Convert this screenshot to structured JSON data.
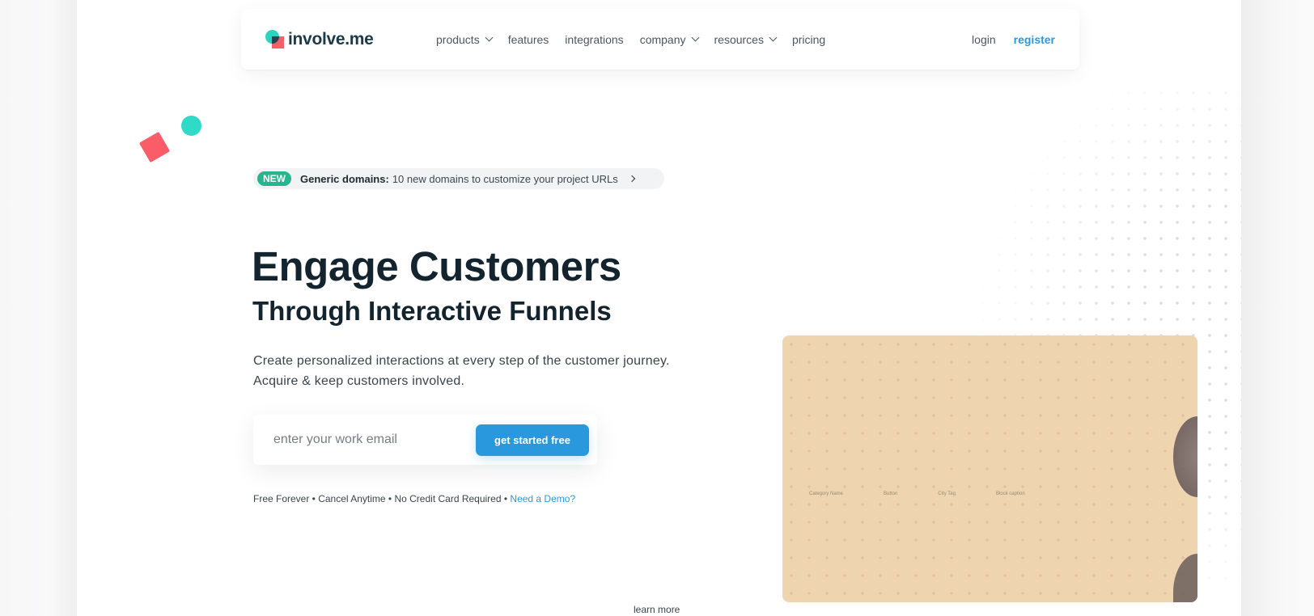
{
  "brand": {
    "name": "involve.me",
    "accent": "#2a98dd",
    "teal": "#2ad4c0",
    "coral": "#f2606a"
  },
  "nav": {
    "items": [
      {
        "label": "products",
        "has_dropdown": true
      },
      {
        "label": "features",
        "has_dropdown": false
      },
      {
        "label": "integrations",
        "has_dropdown": false
      },
      {
        "label": "company",
        "has_dropdown": true
      },
      {
        "label": "resources",
        "has_dropdown": true
      },
      {
        "label": "pricing",
        "has_dropdown": false
      }
    ],
    "login": "login",
    "register": "register"
  },
  "announcement": {
    "badge": "NEW",
    "title": "Generic domains:",
    "text": "10 new domains to customize your project URLs",
    "icon": "chevron-right-icon"
  },
  "hero": {
    "title": "Engage Customers",
    "subtitle": "Through Interactive Funnels",
    "description_line1": "Create personalized interactions at every step of the customer journey.",
    "description_line2": "Acquire & keep customers involved."
  },
  "signup": {
    "email_placeholder": "enter your work email",
    "email_value": "",
    "cta_label": "get started free"
  },
  "footnote": {
    "text": "Free Forever • Cancel Anytime • No Credit Card Required •",
    "demo_link": "Need a Demo?"
  },
  "media": {
    "labels": [
      "Category Name",
      "Button",
      "City Tag",
      "Block caption"
    ]
  },
  "learn_more": "learn more"
}
